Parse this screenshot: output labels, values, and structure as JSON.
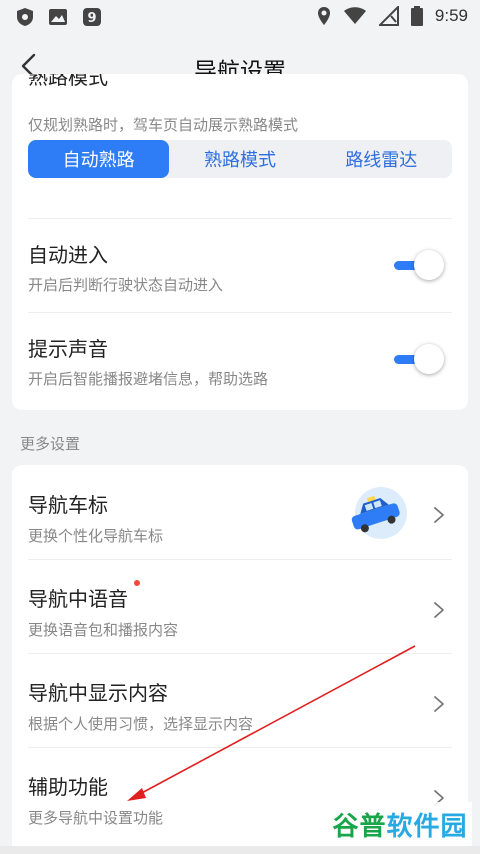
{
  "page": {
    "title": "导航设置"
  },
  "status_bar": {
    "time": "9:59"
  },
  "card1": {
    "clipped_title": "熟路模式",
    "description": "仅规划熟路时，驾车页自动展示熟路模式",
    "segments": [
      {
        "label": "自动熟路",
        "active": true
      },
      {
        "label": "熟路模式",
        "active": false
      },
      {
        "label": "路线雷达",
        "active": false
      }
    ],
    "auto_enter": {
      "title": "自动进入",
      "subtitle": "开启后判断行驶状态自动进入",
      "on": true
    },
    "prompt_sound": {
      "title": "提示声音",
      "subtitle": "开启后智能播报避堵信息，帮助选路",
      "on": true
    }
  },
  "section_label": "更多设置",
  "card2": {
    "items": [
      {
        "title": "导航车标",
        "subtitle": "更换个性化导航车标",
        "has_thumb": true,
        "has_dot": false
      },
      {
        "title": "导航中语音",
        "subtitle": "更换语音包和播报内容",
        "has_thumb": false,
        "has_dot": true
      },
      {
        "title": "导航中显示内容",
        "subtitle": "根据个人使用习惯，选择显示内容",
        "has_thumb": false,
        "has_dot": false
      },
      {
        "title": "辅助功能",
        "subtitle": "更多导航中设置功能",
        "has_thumb": false,
        "has_dot": false
      }
    ]
  },
  "watermark": {
    "part_a": "谷普",
    "part_b": "软件园"
  },
  "colors": {
    "accent": "#2f7df6",
    "badge": "#f04a3e",
    "annotation_arrow": "#e02020"
  }
}
